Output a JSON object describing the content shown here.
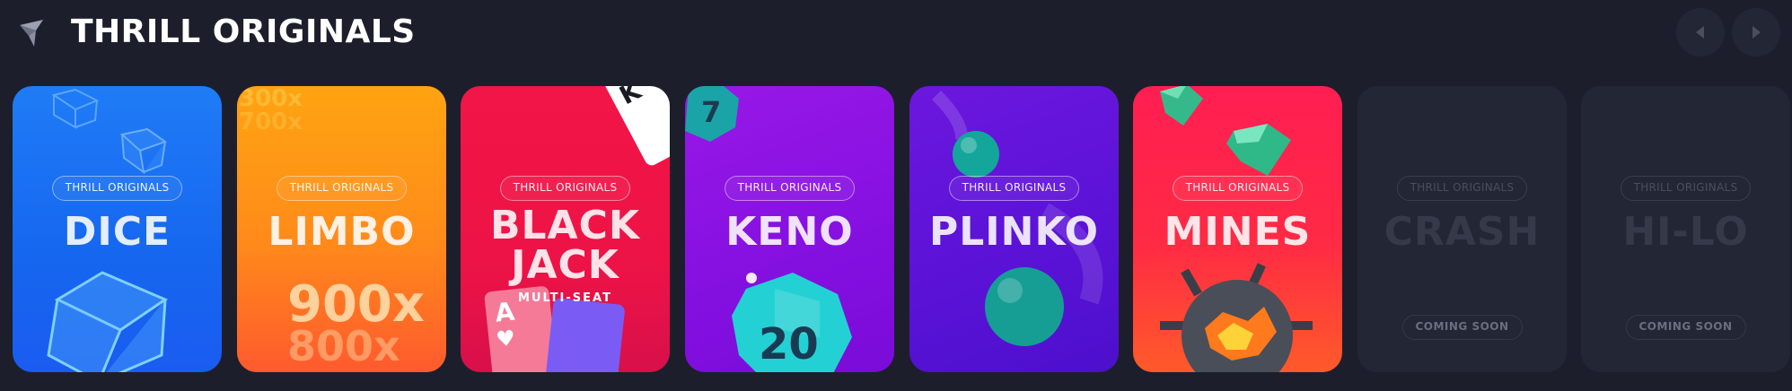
{
  "header": {
    "title": "THRILL ORIGINALS",
    "logo_icon": "thrill-logo-icon",
    "prev_icon": "chevron-left-icon",
    "next_icon": "chevron-right-icon"
  },
  "cards": [
    {
      "badge": "THRILL ORIGINALS",
      "name": "DICE",
      "color": "#1f7cf6"
    },
    {
      "badge": "THRILL ORIGINALS",
      "name": "LIMBO",
      "color": "#ffa411",
      "multipliers": [
        "900x",
        "800x",
        "300x",
        "700x"
      ]
    },
    {
      "badge": "THRILL ORIGINALS",
      "name_line1": "BLACK",
      "name_line2": "JACK",
      "sub": "MULTI-SEAT",
      "color": "#f21547",
      "card_top": "K",
      "card_bottom": "A"
    },
    {
      "badge": "THRILL ORIGINALS",
      "name": "KENO",
      "color": "#9818e8",
      "ball_top": "7",
      "ball_bottom": "20"
    },
    {
      "badge": "THRILL ORIGINALS",
      "name": "PLINKO",
      "color": "#6c17de"
    },
    {
      "badge": "THRILL ORIGINALS",
      "name": "MINES",
      "color": "#ff1e52"
    },
    {
      "badge": "THRILL ORIGINALS",
      "name": "CRASH",
      "status": "COMING SOON",
      "color": "#232634"
    },
    {
      "badge": "THRILL ORIGINALS",
      "name": "HI-LO",
      "status": "COMING SOON",
      "color": "#232634"
    }
  ]
}
